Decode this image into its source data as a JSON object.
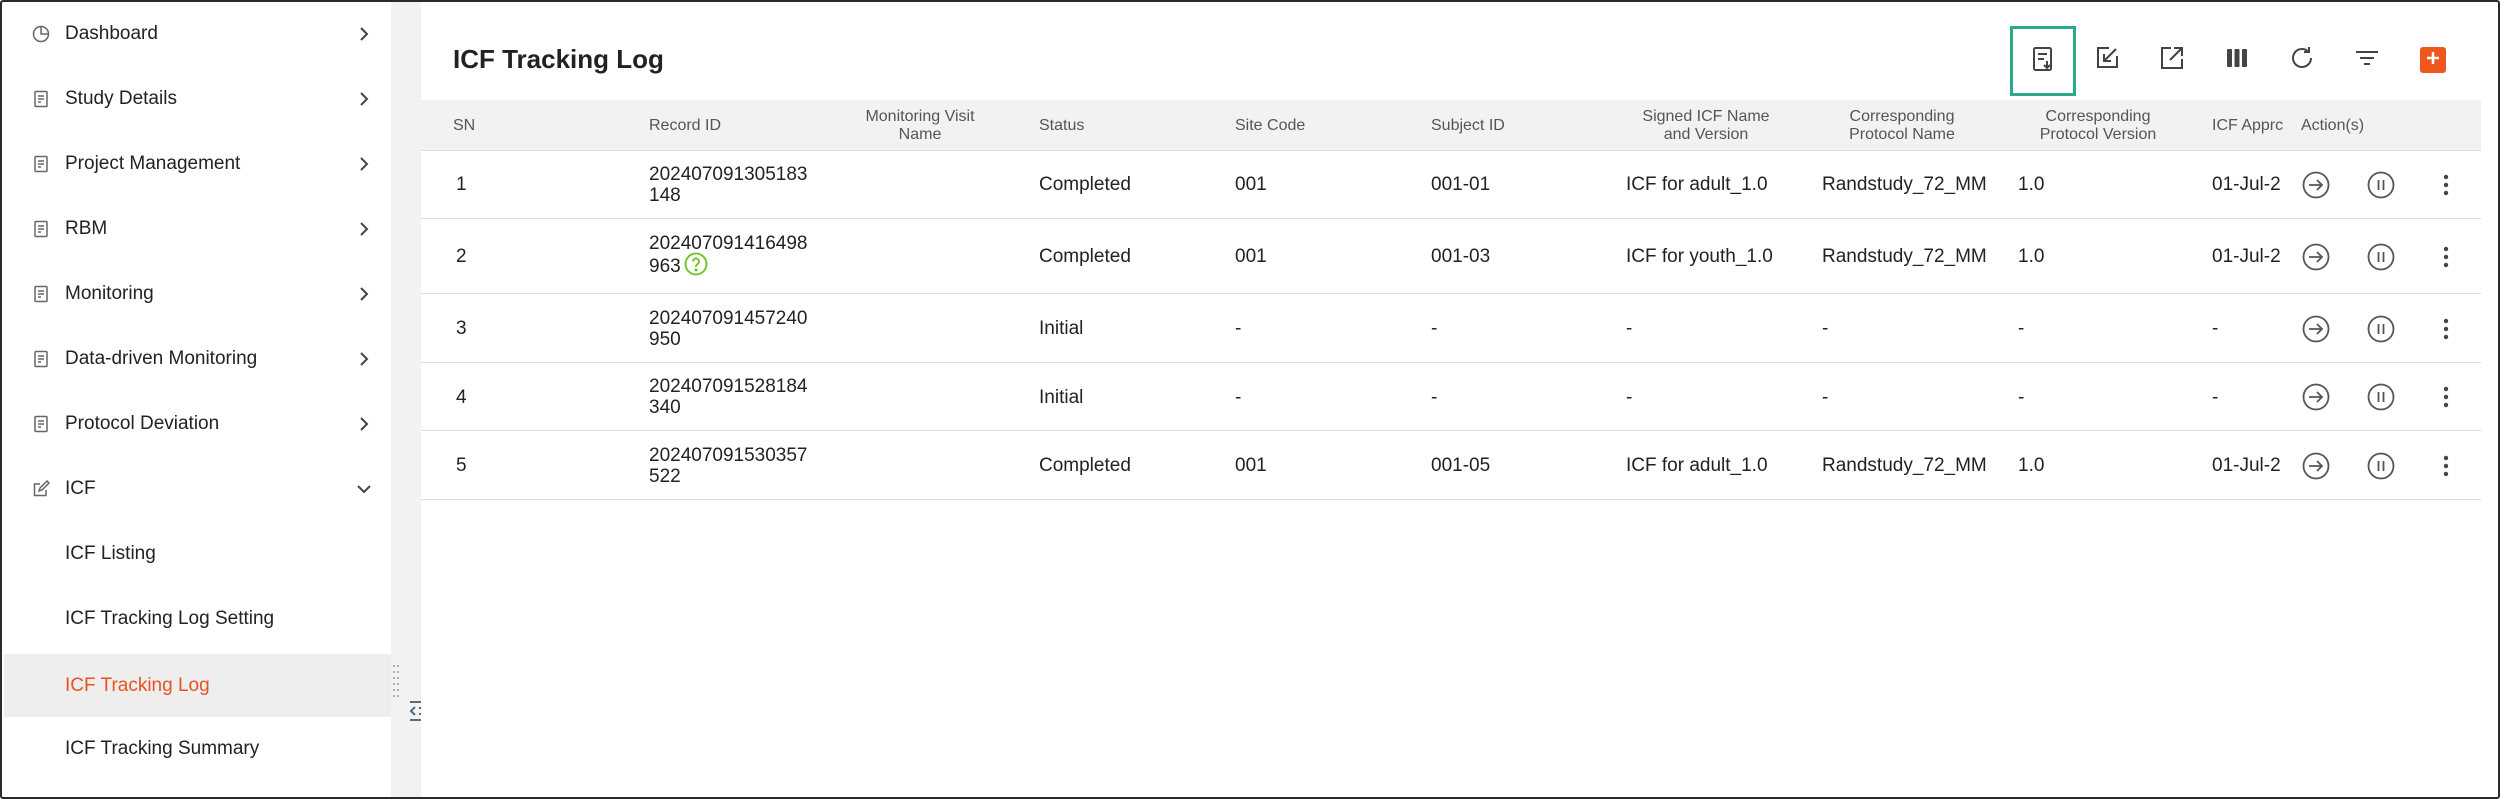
{
  "sidebar": {
    "items": [
      {
        "label": "Dashboard",
        "icon": "pie-chart-icon"
      },
      {
        "label": "Study Details",
        "icon": "document-icon"
      },
      {
        "label": "Project Management",
        "icon": "document-icon"
      },
      {
        "label": "RBM",
        "icon": "document-icon"
      },
      {
        "label": "Monitoring",
        "icon": "document-icon"
      },
      {
        "label": "Data-driven Monitoring",
        "icon": "document-icon"
      },
      {
        "label": "Protocol Deviation",
        "icon": "document-icon"
      },
      {
        "label": "ICF",
        "icon": "edit-icon",
        "expanded": true
      }
    ],
    "icf_children": [
      {
        "label": "ICF Listing"
      },
      {
        "label": "ICF Tracking Log Setting"
      },
      {
        "label": "ICF Tracking Log",
        "active": true
      },
      {
        "label": "ICF Tracking Summary"
      }
    ]
  },
  "main": {
    "title": "ICF Tracking Log",
    "toolbar": [
      "export-list-icon",
      "import-icon",
      "open-external-icon",
      "columns-icon",
      "refresh-icon",
      "filter-icon",
      "add-icon"
    ],
    "columns": {
      "sn": "SN",
      "record_id": "Record ID",
      "visit_line1": "Monitoring Visit",
      "visit_line2": "Name",
      "status": "Status",
      "site_code": "Site Code",
      "subject_id": "Subject ID",
      "signed_line1": "Signed ICF Name",
      "signed_line2": "and Version",
      "cpn_line1": "Corresponding",
      "cpn_line2": "Protocol Name",
      "cpv_line1": "Corresponding",
      "cpv_line2": "Protocol Version",
      "icf_appr": "ICF Apprc",
      "actions": "Action(s)"
    },
    "rows": [
      {
        "sn": "1",
        "rid1": "202407091305183",
        "rid2": "148",
        "status": "Completed",
        "site": "001",
        "subject": "001-01",
        "signed": "ICF for adult_1.0",
        "pname": "Randstudy_72_MM",
        "pver": "1.0",
        "appr": "01-Jul-2"
      },
      {
        "sn": "2",
        "rid1": "202407091416498",
        "rid2": "963",
        "status": "Completed",
        "site": "001",
        "subject": "001-03",
        "signed": "ICF for youth_1.0",
        "pname": "Randstudy_72_MM",
        "pver": "1.0",
        "appr": "01-Jul-2"
      },
      {
        "sn": "3",
        "rid1": "202407091457240",
        "rid2": "950",
        "status": "Initial",
        "site": "-",
        "subject": "-",
        "signed": "-",
        "pname": "-",
        "pver": "-",
        "appr": "-"
      },
      {
        "sn": "4",
        "rid1": "202407091528184",
        "rid2": "340",
        "status": "Initial",
        "site": "-",
        "subject": "-",
        "signed": "-",
        "pname": "-",
        "pver": "-",
        "appr": "-"
      },
      {
        "sn": "5",
        "rid1": "202407091530357",
        "rid2": "522",
        "status": "Completed",
        "site": "001",
        "subject": "001-05",
        "signed": "ICF for adult_1.0",
        "pname": "Randstudy_72_MM",
        "pver": "1.0",
        "appr": "01-Jul-2"
      }
    ]
  },
  "colors": {
    "accent": "#e8531f",
    "highlight": "#2aa98b",
    "help": "#6cc21c"
  }
}
